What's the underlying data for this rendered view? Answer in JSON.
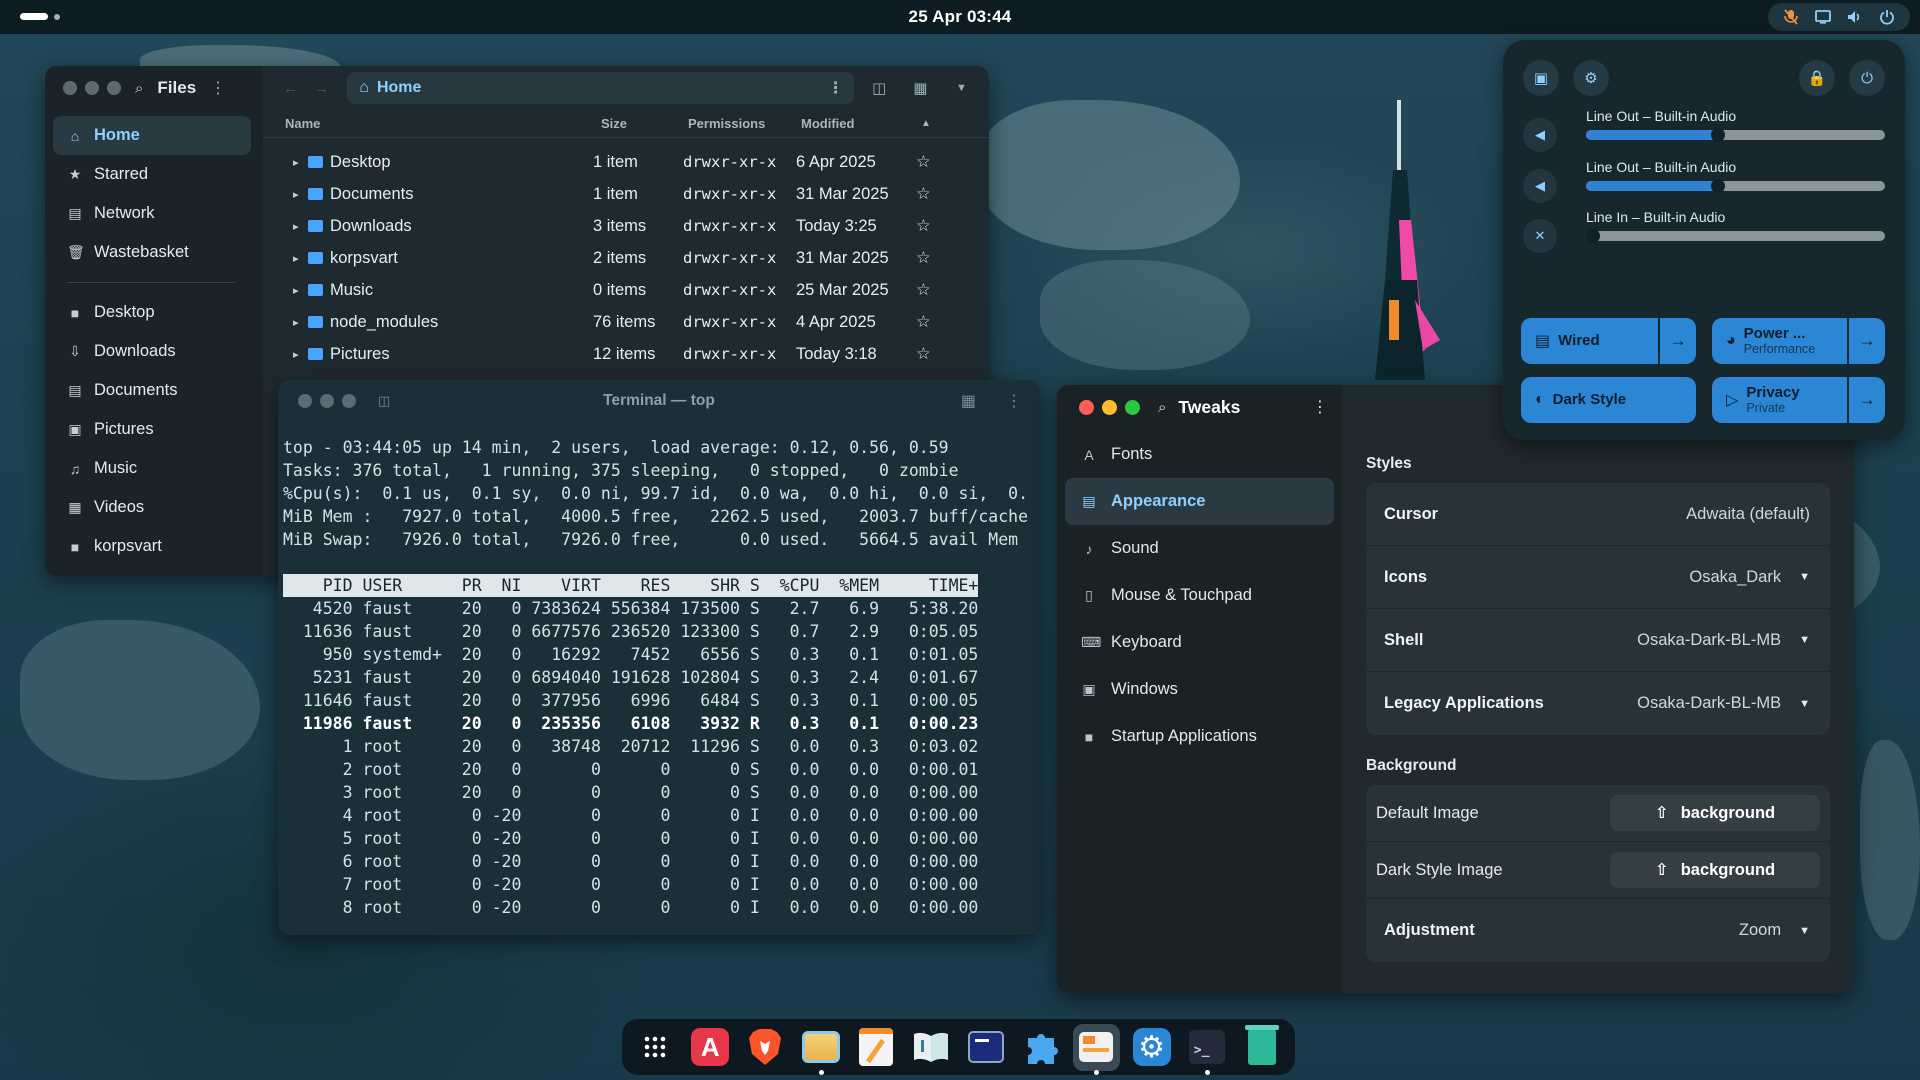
{
  "topbar": {
    "clock": "25 Apr  03:44",
    "tray_icons": [
      "mic-muted-icon",
      "screen-icon",
      "volume-icon",
      "power-icon"
    ]
  },
  "files": {
    "app_title": "Files",
    "path": "Home",
    "sidebar": [
      {
        "label": "Home",
        "icon": "home-icon",
        "active": true
      },
      {
        "label": "Starred",
        "icon": "star-icon"
      },
      {
        "label": "Network",
        "icon": "network-icon"
      },
      {
        "label": "Wastebasket",
        "icon": "trash-icon"
      },
      {
        "label": "Desktop",
        "icon": "folder-icon"
      },
      {
        "label": "Downloads",
        "icon": "download-icon"
      },
      {
        "label": "Documents",
        "icon": "document-icon"
      },
      {
        "label": "Pictures",
        "icon": "picture-icon"
      },
      {
        "label": "Music",
        "icon": "music-icon"
      },
      {
        "label": "Videos",
        "icon": "video-icon"
      },
      {
        "label": "korpsvart",
        "icon": "folder-icon"
      }
    ],
    "columns": {
      "name": "Name",
      "size": "Size",
      "permissions": "Permissions",
      "modified": "Modified"
    },
    "rows": [
      {
        "name": "Desktop",
        "size": "1 item",
        "perm": "drwxr-xr-x",
        "mod": "6 Apr 2025"
      },
      {
        "name": "Documents",
        "size": "1 item",
        "perm": "drwxr-xr-x",
        "mod": "31 Mar 2025"
      },
      {
        "name": "Downloads",
        "size": "3 items",
        "perm": "drwxr-xr-x",
        "mod": "Today 3:25"
      },
      {
        "name": "korpsvart",
        "size": "2 items",
        "perm": "drwxr-xr-x",
        "mod": "31 Mar 2025"
      },
      {
        "name": "Music",
        "size": "0 items",
        "perm": "drwxr-xr-x",
        "mod": "25 Mar 2025"
      },
      {
        "name": "node_modules",
        "size": "76 items",
        "perm": "drwxr-xr-x",
        "mod": "4 Apr 2025"
      },
      {
        "name": "Pictures",
        "size": "12 items",
        "perm": "drwxr-xr-x",
        "mod": "Today 3:18"
      }
    ]
  },
  "terminal": {
    "title": "Terminal — top",
    "summary": [
      "top - 03:44:05 up 14 min,  2 users,  load average: 0.12, 0.56, 0.59",
      "Tasks: 376 total,   1 running, 375 sleeping,   0 stopped,   0 zombie",
      "%Cpu(s):  0.1 us,  0.1 sy,  0.0 ni, 99.7 id,  0.0 wa,  0.0 hi,  0.0 si,  0.",
      "MiB Mem :   7927.0 total,   4000.5 free,   2262.5 used,   2003.7 buff/cache",
      "MiB Swap:   7926.0 total,   7926.0 free,      0.0 used.   5664.5 avail Mem"
    ],
    "header": "    PID USER      PR  NI    VIRT    RES    SHR S  %CPU  %MEM     TIME+",
    "processes": [
      "   4520 faust     20   0 7383624 556384 173500 S   2.7   6.9   5:38.20",
      "  11636 faust     20   0 6677576 236520 123300 S   0.7   2.9   0:05.05",
      "    950 systemd+  20   0   16292   7452   6556 S   0.3   0.1   0:01.05",
      "   5231 faust     20   0 6894040 191628 102804 S   0.3   2.4   0:01.67",
      "  11646 faust     20   0  377956   6996   6484 S   0.3   0.1   0:00.05",
      "  11986 faust     20   0  235356   6108   3932 R   0.3   0.1   0:00.23",
      "      1 root      20   0   38748  20712  11296 S   0.0   0.3   0:03.02",
      "      2 root      20   0       0      0      0 S   0.0   0.0   0:00.01",
      "      3 root      20   0       0      0      0 S   0.0   0.0   0:00.00",
      "      4 root       0 -20       0      0      0 I   0.0   0.0   0:00.00",
      "      5 root       0 -20       0      0      0 I   0.0   0.0   0:00.00",
      "      6 root       0 -20       0      0      0 I   0.0   0.0   0:00.00",
      "      7 root       0 -20       0      0      0 I   0.0   0.0   0:00.00",
      "      8 root       0 -20       0      0      0 I   0.0   0.0   0:00.00"
    ]
  },
  "tweaks": {
    "app_title": "Tweaks",
    "nav": [
      {
        "label": "Fonts",
        "icon": "font-icon"
      },
      {
        "label": "Appearance",
        "icon": "appearance-icon",
        "active": true
      },
      {
        "label": "Sound",
        "icon": "sound-icon"
      },
      {
        "label": "Mouse & Touchpad",
        "icon": "mouse-icon"
      },
      {
        "label": "Keyboard",
        "icon": "keyboard-icon"
      },
      {
        "label": "Windows",
        "icon": "windows-icon"
      },
      {
        "label": "Startup Applications",
        "icon": "folder-icon"
      }
    ],
    "styles_header": "Styles",
    "styles": [
      {
        "label": "Cursor",
        "value": "Adwaita (default)",
        "dropdown": false
      },
      {
        "label": "Icons",
        "value": "Osaka_Dark",
        "dropdown": true
      },
      {
        "label": "Shell",
        "value": "Osaka-Dark-BL-MB",
        "dropdown": true
      },
      {
        "label": "Legacy Applications",
        "value": "Osaka-Dark-BL-MB",
        "dropdown": true
      }
    ],
    "background_header": "Background",
    "default_image_label": "Default Image",
    "default_image_button": "background",
    "dark_image_label": "Dark Style Image",
    "dark_image_button": "background",
    "adjustment_label": "Adjustment",
    "adjustment_value": "Zoom"
  },
  "quick_settings": {
    "sliders": [
      {
        "label": "Line Out – Built-in Audio",
        "level": 0.44
      },
      {
        "label": "Line Out – Built-in Audio",
        "level": 0.44
      },
      {
        "label": "Line In – Built-in Audio",
        "level": 0.0
      }
    ],
    "wired": "Wired",
    "power_title": "Power ...",
    "power_sub": "Performance",
    "dark_style": "Dark Style",
    "privacy_title": "Privacy",
    "privacy_sub": "Private"
  },
  "dock": [
    "app-grid-icon",
    "app-store-icon",
    "brave-icon",
    "files-icon",
    "text-editor-icon",
    "book-reader-icon",
    "terminal-app-icon",
    "extensions-icon",
    "tweaks-icon",
    "settings-icon",
    "console-icon",
    "trash-app-icon"
  ],
  "colors": {
    "accent": "#8fd0ff",
    "tile_blue": "#2b86d6",
    "close": "#ff5f57",
    "minimize": "#febc2e",
    "maximize": "#28c840"
  }
}
